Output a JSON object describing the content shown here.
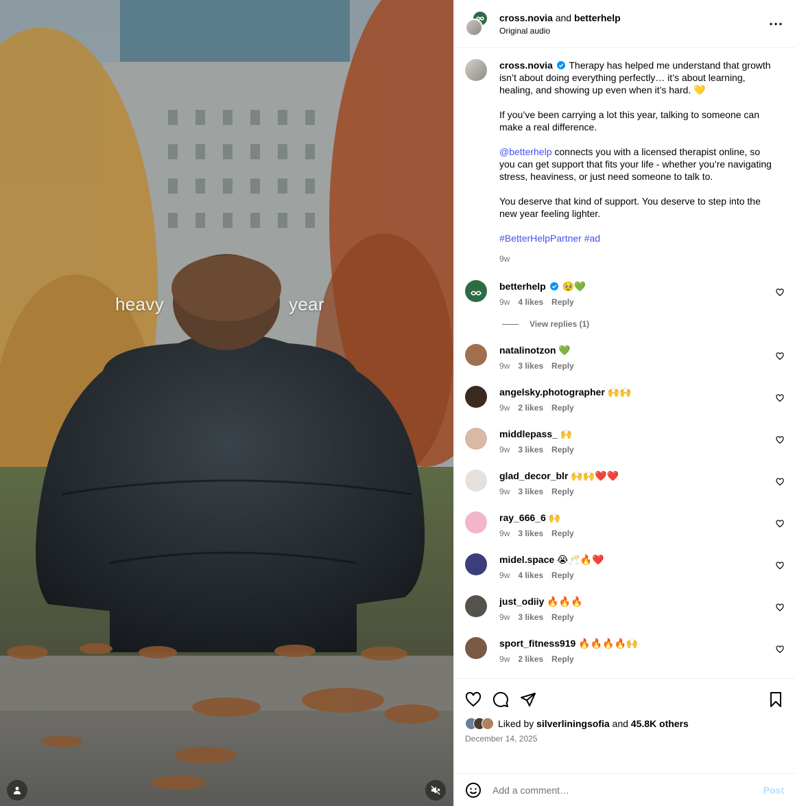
{
  "media": {
    "overlay_left": "heavy",
    "overlay_right": "year"
  },
  "header": {
    "user1": "cross.novia",
    "and": "and",
    "user2": "betterhelp",
    "audio": "Original audio"
  },
  "caption": {
    "username": "cross.novia",
    "p1": "Therapy has helped me understand that growth isn’t about doing everything perfectly… it’s about learning, healing, and showing up even when it’s hard. 💛",
    "p2": "If you’ve been carrying a lot this year, talking to someone can make a real difference.",
    "p3_mention": "@betterhelp",
    "p3_rest": " connects you with a licensed therapist online, so you can get support that fits your life - whether you’re navigating stress, heaviness, or just need someone to talk to.",
    "p4": "You deserve that kind of support. You deserve to step into the new year feeling lighter.",
    "hashtags": "#BetterHelpPartner #ad",
    "time": "9w"
  },
  "comments": [
    {
      "user": "betterhelp",
      "text": "🥹💚",
      "time": "9w",
      "likes": "4 likes",
      "reply": "Reply",
      "verified": true,
      "avatar_color": "#2e6b45"
    },
    {
      "user": "natalinotzon",
      "text": "💚",
      "time": "9w",
      "likes": "3 likes",
      "reply": "Reply",
      "avatar_color": "#a0704e"
    },
    {
      "user": "angelsky.photographer",
      "text": "🙌🙌",
      "time": "9w",
      "likes": "2 likes",
      "reply": "Reply",
      "avatar_color": "#3a2a20"
    },
    {
      "user": "middlepass_",
      "text": "🙌",
      "time": "9w",
      "likes": "3 likes",
      "reply": "Reply",
      "avatar_color": "#d9b9a5"
    },
    {
      "user": "glad_decor_blr",
      "text": "🙌🙌❤️❤️",
      "time": "9w",
      "likes": "3 likes",
      "reply": "Reply",
      "avatar_color": "#e6e0dc"
    },
    {
      "user": "ray_666_6",
      "text": "🙌",
      "time": "9w",
      "likes": "3 likes",
      "reply": "Reply",
      "avatar_color": "#f1b7c8"
    },
    {
      "user": "midel.space",
      "text": "😭🥂🔥❤️",
      "time": "9w",
      "likes": "4 likes",
      "reply": "Reply",
      "avatar_color": "#3b3e7a"
    },
    {
      "user": "just_odiiy",
      "text": "🔥🔥🔥",
      "time": "9w",
      "likes": "3 likes",
      "reply": "Reply",
      "avatar_color": "#55524c"
    },
    {
      "user": "sport_fitness919",
      "text": "🔥🔥🔥🔥🙌",
      "time": "9w",
      "likes": "2 likes",
      "reply": "Reply",
      "avatar_color": "#7a5a45"
    }
  ],
  "view_replies": "View replies (1)",
  "likes_line": {
    "prefix": "Liked by",
    "user": "silverliningsofia",
    "and": "and",
    "others": "45.8K others"
  },
  "date": "December 14, 2025",
  "add_comment": {
    "placeholder": "Add a comment…",
    "post": "Post"
  }
}
